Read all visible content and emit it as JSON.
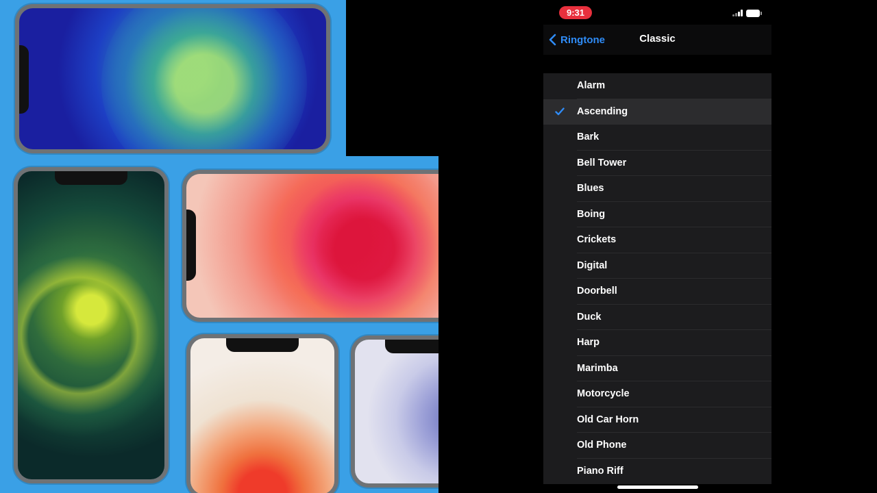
{
  "status_bar": {
    "time": "9:31",
    "signal_icon": "cellular-signal-icon",
    "battery_icon": "battery-icon",
    "time_pill_color": "#e8303d"
  },
  "nav": {
    "back_label": "Ringtone",
    "back_icon": "chevron-left-icon",
    "title": "Classic",
    "accent_color": "#2f8cf7"
  },
  "tones": [
    {
      "label": "Alarm",
      "selected": false
    },
    {
      "label": "Ascending",
      "selected": true
    },
    {
      "label": "Bark",
      "selected": false
    },
    {
      "label": "Bell Tower",
      "selected": false
    },
    {
      "label": "Blues",
      "selected": false
    },
    {
      "label": "Boing",
      "selected": false
    },
    {
      "label": "Crickets",
      "selected": false
    },
    {
      "label": "Digital",
      "selected": false
    },
    {
      "label": "Doorbell",
      "selected": false
    },
    {
      "label": "Duck",
      "selected": false
    },
    {
      "label": "Harp",
      "selected": false
    },
    {
      "label": "Marimba",
      "selected": false
    },
    {
      "label": "Motorcycle",
      "selected": false
    },
    {
      "label": "Old Car Horn",
      "selected": false
    },
    {
      "label": "Old Phone",
      "selected": false
    },
    {
      "label": "Piano Riff",
      "selected": false
    }
  ],
  "checkmark_icon": "checkmark-icon",
  "artwork": {
    "description_icon": "iphone-wallpaper-collage"
  }
}
